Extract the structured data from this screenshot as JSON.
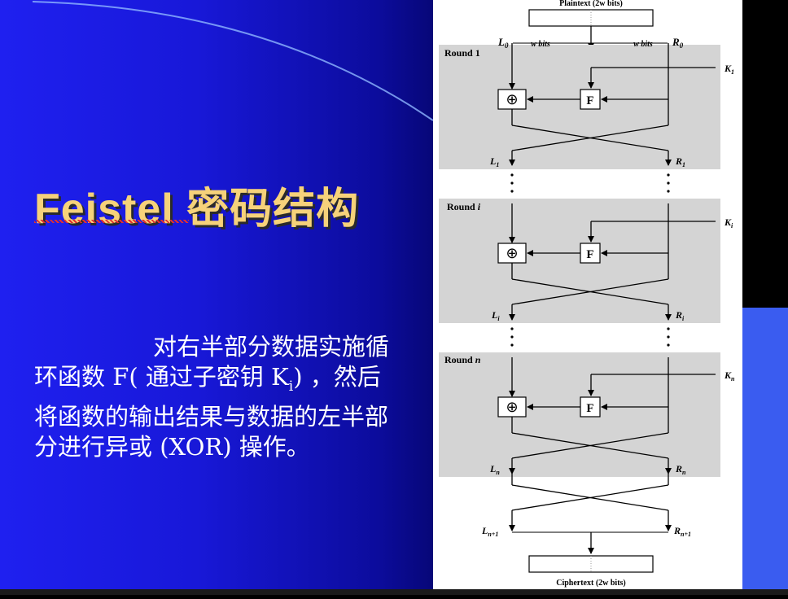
{
  "slide": {
    "title": "Feistel 密码结构",
    "body": {
      "part1": "对右半部分数据实施循环函数 F( 通过子密钥 K",
      "sub": "i",
      "part2": ") ，然后将函数的输出结果与数据的左半部分进行异或 (XOR) 操作。"
    }
  },
  "diagram": {
    "plaintext": "Plaintext (2w bits)",
    "ciphertext": "Ciphertext (2w bits)",
    "wbits": "w bits",
    "f_label": "F",
    "xor_symbol": "⊕",
    "rounds": [
      {
        "label_pre": "Round ",
        "label_var": "1",
        "key": "K",
        "key_sub": "1",
        "l_top": "L",
        "l_top_sub": "0",
        "r_top": "R",
        "r_top_sub": "0",
        "l_out": "L",
        "l_out_sub": "1",
        "r_out": "R",
        "r_out_sub": "1"
      },
      {
        "label_pre": "Round ",
        "label_var": "i",
        "key": "K",
        "key_sub": "i",
        "l_out": "L",
        "l_out_sub": "i",
        "r_out": "R",
        "r_out_sub": "i"
      },
      {
        "label_pre": "Round ",
        "label_var": "n",
        "key": "K",
        "key_sub": "n",
        "l_out": "L",
        "l_out_sub": "n",
        "r_out": "R",
        "r_out_sub": "n"
      }
    ],
    "final": {
      "l": "L",
      "l_sub": "n+1",
      "r": "R",
      "r_sub": "n+1"
    }
  }
}
